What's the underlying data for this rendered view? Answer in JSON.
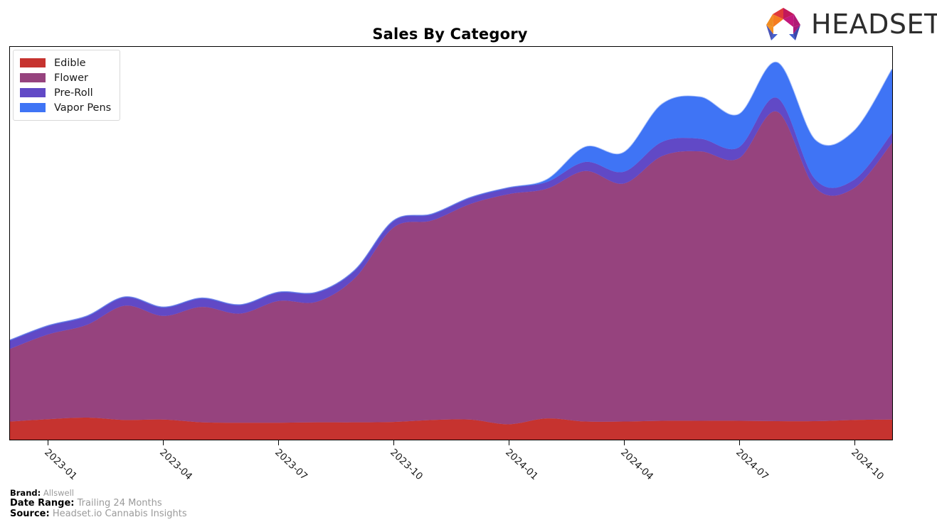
{
  "header": {
    "title": "Sales By Category",
    "logo_text": "HEADSET",
    "logo_icon": "headset-hexagon-logo"
  },
  "legend": {
    "position": "top-left",
    "items": [
      {
        "label": "Edible",
        "color": "#c6332f"
      },
      {
        "label": "Flower",
        "color": "#96437e"
      },
      {
        "label": "Pre-Roll",
        "color": "#6149c6"
      },
      {
        "label": "Vapor Pens",
        "color": "#3f74f5"
      }
    ]
  },
  "footer": {
    "brand_key": "Brand:",
    "brand_value": "Allswell",
    "date_range_key": "Date Range:",
    "date_range_value": "Trailing 24 Months",
    "source_key": "Source:",
    "source_value": "Headset.io Cannabis Insights"
  },
  "chart_data": {
    "type": "area",
    "stacked": true,
    "smoothing": "spline",
    "title": "Sales By Category",
    "xlabel": "",
    "ylabel": "",
    "grid": false,
    "legend_position": "top-left",
    "x_tick_labels": [
      "2023-01",
      "2023-04",
      "2023-07",
      "2023-10",
      "2024-01",
      "2024-04",
      "2024-07",
      "2024-10"
    ],
    "x_tick_indices": [
      1,
      4,
      7,
      10,
      13,
      16,
      19,
      22
    ],
    "x": [
      "2022-12",
      "2023-01",
      "2023-02",
      "2023-03",
      "2023-04",
      "2023-05",
      "2023-06",
      "2023-07",
      "2023-08",
      "2023-09",
      "2023-10",
      "2023-11",
      "2023-12",
      "2024-01",
      "2024-02",
      "2024-03",
      "2024-04",
      "2024-05",
      "2024-06",
      "2024-07",
      "2024-08",
      "2024-09",
      "2024-10",
      "2024-11"
    ],
    "ylim": [
      0,
      100
    ],
    "y_axis_visible": false,
    "series": [
      {
        "name": "Edible",
        "color": "#c6332f",
        "values": [
          4.6,
          5.2,
          5.6,
          5.0,
          5.1,
          4.4,
          4.3,
          4.3,
          4.4,
          4.4,
          4.5,
          5.0,
          5.1,
          3.9,
          5.4,
          4.6,
          4.6,
          4.8,
          4.8,
          4.8,
          4.7,
          4.7,
          5.0,
          5.1
        ]
      },
      {
        "name": "Flower",
        "color": "#96437e",
        "values": [
          18.5,
          21.6,
          23.6,
          29.1,
          26.4,
          29.4,
          27.8,
          31.0,
          30.7,
          36.8,
          49.5,
          50.8,
          54.9,
          58.6,
          58.5,
          63.8,
          60.6,
          67.4,
          68.6,
          66.8,
          78.8,
          59.4,
          59.0,
          70.5
        ]
      },
      {
        "name": "Pre-Roll",
        "color": "#6149c6",
        "values": [
          2.2,
          2.2,
          2.2,
          2.2,
          2.2,
          2.2,
          2.2,
          2.2,
          2.4,
          2.0,
          1.7,
          1.6,
          1.6,
          1.6,
          1.7,
          2.3,
          3.0,
          3.6,
          3.2,
          2.8,
          3.5,
          2.1,
          2.1,
          2.5
        ]
      },
      {
        "name": "Vapor Pens",
        "color": "#3f74f5",
        "values": [
          0.0,
          0.0,
          0.0,
          0.0,
          0.0,
          0.0,
          0.0,
          0.0,
          0.0,
          0.0,
          0.0,
          0.0,
          0.0,
          0.0,
          0.6,
          3.8,
          4.9,
          9.6,
          10.6,
          8.4,
          9.0,
          10.0,
          12.4,
          16.2
        ]
      }
    ]
  }
}
